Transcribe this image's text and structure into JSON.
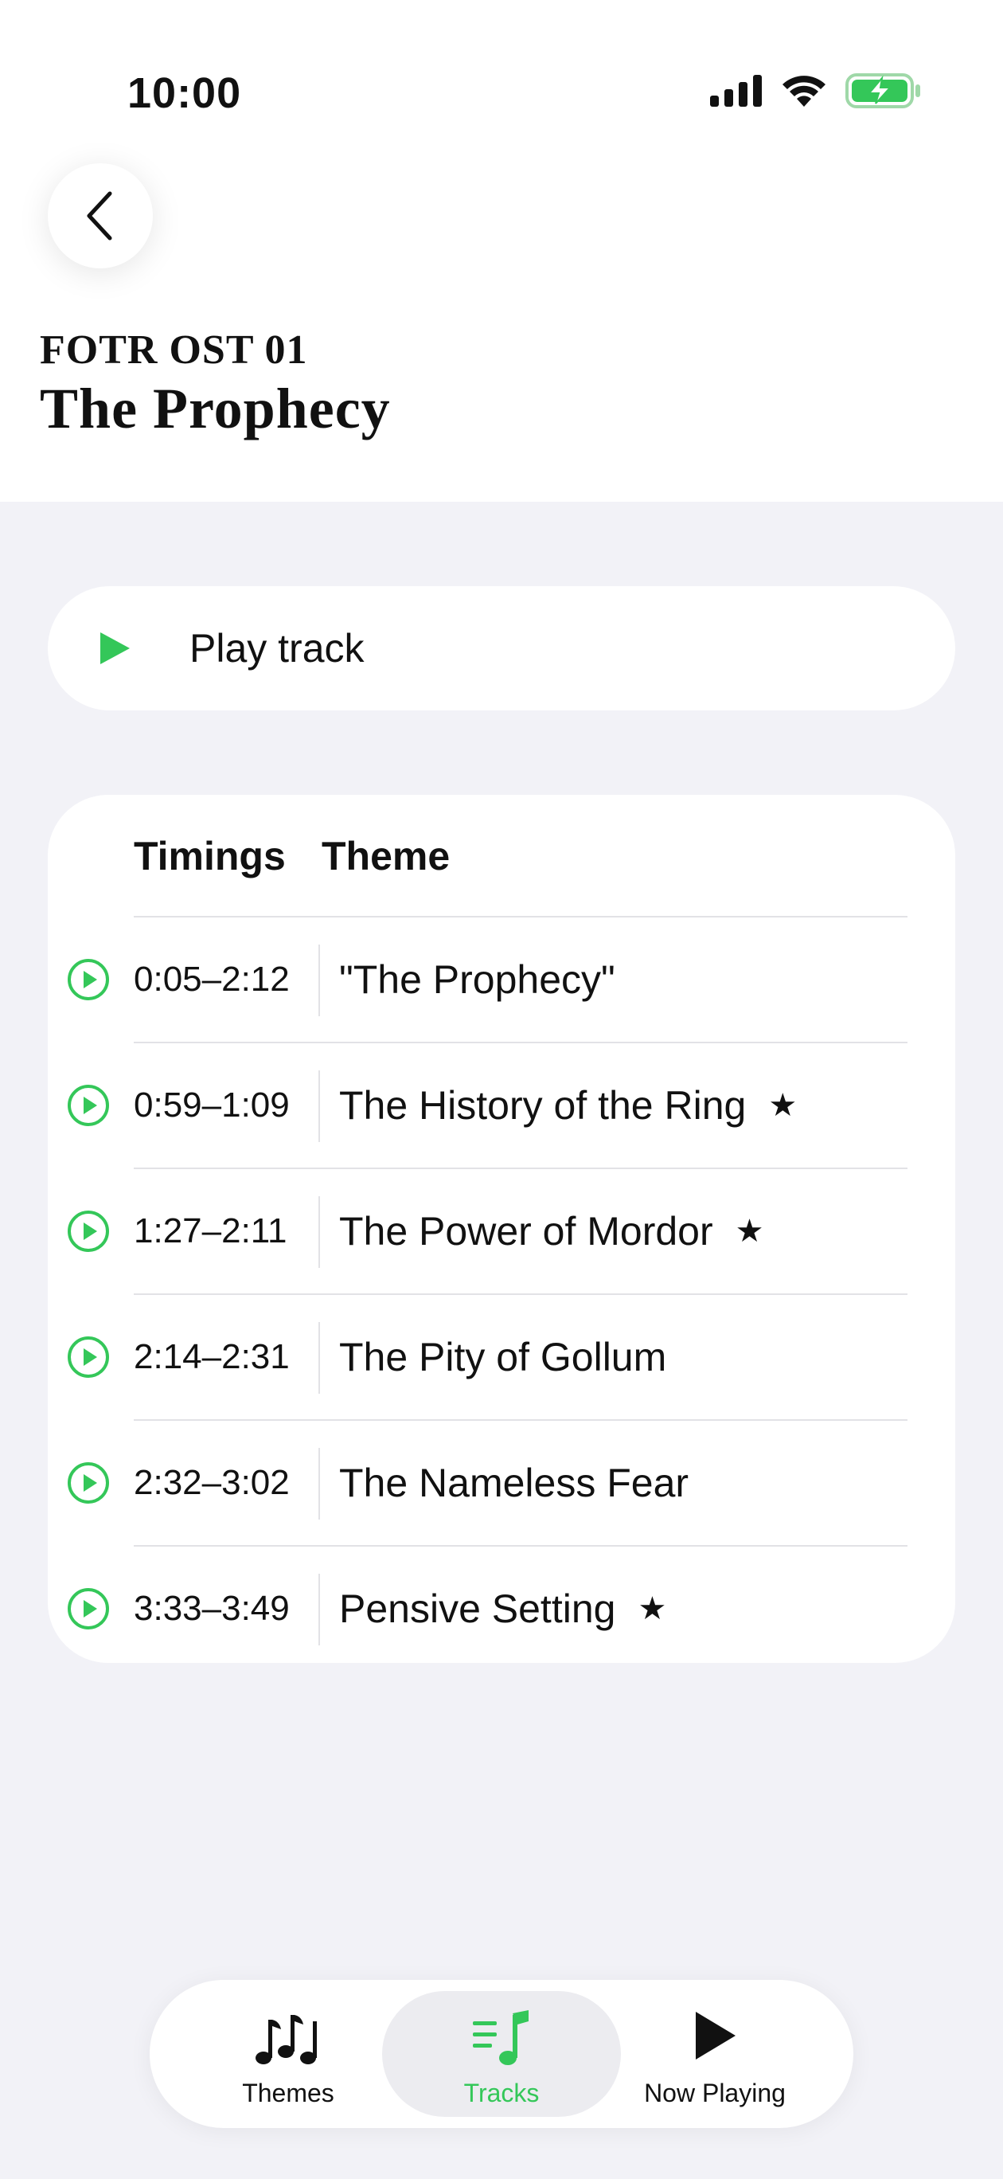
{
  "status_bar": {
    "time": "10:00"
  },
  "header": {
    "track_id": "FOTR OST 01",
    "track_title": "The Prophecy"
  },
  "play_track": {
    "label": "Play track"
  },
  "themes_table": {
    "columns": [
      "Timings",
      "Theme"
    ],
    "rows": [
      {
        "timing": "0:05–2:12",
        "theme": "\"The Prophecy\"",
        "starred": false
      },
      {
        "timing": "0:59–1:09",
        "theme": "The History of the Ring",
        "starred": true
      },
      {
        "timing": "1:27–2:11",
        "theme": "The Power of Mordor",
        "starred": true
      },
      {
        "timing": "2:14–2:31",
        "theme": "The Pity of Gollum",
        "starred": false
      },
      {
        "timing": "2:32–3:02",
        "theme": "The Nameless Fear",
        "starred": false
      },
      {
        "timing": "3:33–3:49",
        "theme": "Pensive Setting",
        "starred": true
      }
    ],
    "star_glyph": "★"
  },
  "tab_bar": {
    "tabs": [
      {
        "label": "Themes",
        "icon": "music-notes-icon",
        "active": false
      },
      {
        "label": "Tracks",
        "icon": "music-list-icon",
        "active": true
      },
      {
        "label": "Now Playing",
        "icon": "play-icon",
        "active": false
      }
    ]
  },
  "colors": {
    "accent": "#34c759",
    "background": "#f2f2f7",
    "card": "#ffffff",
    "text": "#111111"
  }
}
